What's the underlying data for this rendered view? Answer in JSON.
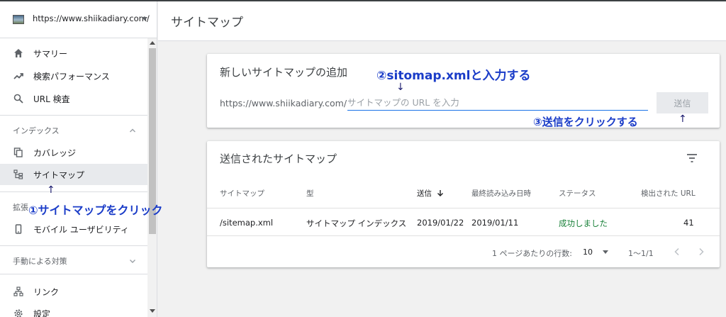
{
  "sidebar": {
    "property_url": "https://www.shiikadiary.com/",
    "items": [
      {
        "label": "サマリー",
        "icon": "home-icon"
      },
      {
        "label": "検索パフォーマンス",
        "icon": "trending-up-icon"
      },
      {
        "label": "URL 検査",
        "icon": "search-icon"
      }
    ],
    "index_section": {
      "label": "インデックス",
      "items": [
        {
          "label": "カバレッジ",
          "icon": "copy-icon"
        },
        {
          "label": "サイトマップ",
          "icon": "sitemap-icon"
        }
      ]
    },
    "enhancements_section": {
      "label": "拡張",
      "items": [
        {
          "label": "モバイル ユーザビリティ",
          "icon": "phone-icon"
        }
      ]
    },
    "manual_actions_section": {
      "label": "手動による対策"
    },
    "bottom_items": [
      {
        "label": "リンク",
        "icon": "links-icon"
      },
      {
        "label": "設定",
        "icon": "gear-icon"
      }
    ]
  },
  "header": {
    "title": "サイトマップ"
  },
  "add_card": {
    "title": "新しいサイトマップの追加",
    "url_prefix": "https://www.shiikadiary.com/",
    "input_placeholder": "サイトマップの URL を入力",
    "submit_label": "送信"
  },
  "submitted_card": {
    "title": "送信されたサイトマップ",
    "columns": [
      "サイトマップ",
      "型",
      "送信",
      "最終読み込み日時",
      "ステータス",
      "検出された URL"
    ],
    "rows": [
      {
        "sitemap": "/sitemap.xml",
        "type": "サイトマップ インデックス",
        "submitted": "2019/01/22",
        "last_read": "2019/01/11",
        "status": "成功しました",
        "discovered_urls": "41"
      }
    ],
    "pagination": {
      "rows_per_page_label": "1 ページあたりの行数:",
      "rows_per_page": "10",
      "range": "1〜1/1"
    }
  },
  "annotations": {
    "step1": "①サイトマップをクリック",
    "step2": "②sitomap.xmlと入力する",
    "step3": "③送信をクリックする",
    "arrow_up": "↑",
    "arrow_down": "↓"
  },
  "colors": {
    "link_blue": "#1a73e8",
    "success_green": "#188038",
    "annotation_blue": "#1a3cc8"
  }
}
